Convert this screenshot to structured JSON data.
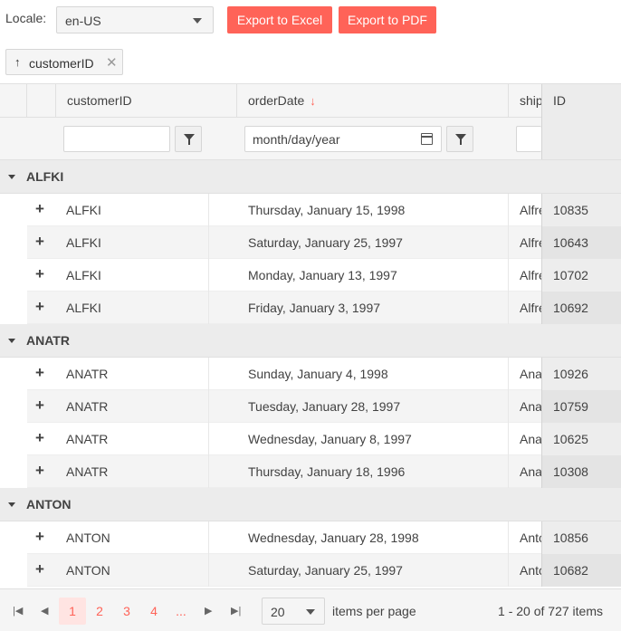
{
  "toolbar": {
    "locale_label": "Locale:",
    "locale_value": "en-US",
    "export_excel": "Export to Excel",
    "export_pdf": "Export to PDF"
  },
  "grouping": {
    "chip_label": "customerID",
    "chip_sort_icon": "arrow-up-icon",
    "chip_close": "✕"
  },
  "columns": {
    "customer": "customerID",
    "order_date": "orderDate",
    "ship": "ship",
    "id": "ID"
  },
  "filters": {
    "customer_value": "",
    "date_placeholder": "month/day/year"
  },
  "groups": [
    {
      "name": "ALFKI",
      "rows": [
        {
          "customer": "ALFKI",
          "date": "Thursday, January 15, 1998",
          "ship": "Alfreds",
          "id": "10835"
        },
        {
          "customer": "ALFKI",
          "date": "Saturday, January 25, 1997",
          "ship": "Alfreds",
          "id": "10643"
        },
        {
          "customer": "ALFKI",
          "date": "Monday, January 13, 1997",
          "ship": "Alfreds",
          "id": "10702"
        },
        {
          "customer": "ALFKI",
          "date": "Friday, January 3, 1997",
          "ship": "Alfreds",
          "id": "10692"
        }
      ]
    },
    {
      "name": "ANATR",
      "rows": [
        {
          "customer": "ANATR",
          "date": "Sunday, January 4, 1998",
          "ship": "Ana",
          "id": "10926"
        },
        {
          "customer": "ANATR",
          "date": "Tuesday, January 28, 1997",
          "ship": "Ana",
          "id": "10759"
        },
        {
          "customer": "ANATR",
          "date": "Wednesday, January 8, 1997",
          "ship": "Ana",
          "id": "10625"
        },
        {
          "customer": "ANATR",
          "date": "Thursday, January 18, 1996",
          "ship": "Ana",
          "id": "10308"
        }
      ]
    },
    {
      "name": "ANTON",
      "rows": [
        {
          "customer": "ANTON",
          "date": "Wednesday, January 28, 1998",
          "ship": "Antonio",
          "id": "10856"
        },
        {
          "customer": "ANTON",
          "date": "Saturday, January 25, 1997",
          "ship": "Antonio",
          "id": "10682"
        }
      ]
    }
  ],
  "pager": {
    "pages": [
      "1",
      "2",
      "3",
      "4",
      "..."
    ],
    "current_page": "1",
    "page_size": "20",
    "items_per_page": "items per page",
    "info": "1 - 20 of 727 items"
  },
  "colors": {
    "accent": "#ff6358",
    "header_bg": "#f5f5f5",
    "group_bg": "#ececec"
  }
}
